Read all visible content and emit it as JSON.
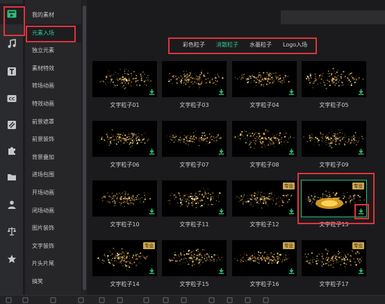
{
  "rail": {
    "items": [
      {
        "icon": "media-library-icon",
        "active": true
      },
      {
        "icon": "music-note-icon"
      },
      {
        "icon": "text-t-icon"
      },
      {
        "icon": "subtitle-cc-icon"
      },
      {
        "icon": "filter-icon"
      },
      {
        "icon": "puzzle-icon"
      },
      {
        "icon": "folder-icon"
      },
      {
        "icon": "person-icon"
      },
      {
        "icon": "balance-scale-icon"
      },
      {
        "icon": "star-icon"
      }
    ]
  },
  "menu": {
    "items": [
      {
        "label": "我的素材"
      },
      {
        "label": "元素入场",
        "active": true
      },
      {
        "label": "独立元素"
      },
      {
        "label": "素材特效"
      },
      {
        "label": "转场动画"
      },
      {
        "label": "特效动画"
      },
      {
        "label": "前景遮罩"
      },
      {
        "label": "前景装饰"
      },
      {
        "label": "背景叠加"
      },
      {
        "label": "进场包围"
      },
      {
        "label": "开场动画"
      },
      {
        "label": "闭场动画"
      },
      {
        "label": "图片装饰"
      },
      {
        "label": "文字装饰"
      },
      {
        "label": "片头片尾"
      },
      {
        "label": "搞笑"
      }
    ]
  },
  "subtabs": [
    {
      "label": "彩色粒子"
    },
    {
      "label": "消散粒子",
      "active": true
    },
    {
      "label": "水墨粒子"
    },
    {
      "label": "Logo入场"
    }
  ],
  "grid": {
    "pro_label": "专业",
    "items": [
      {
        "label": "文字粒子01"
      },
      {
        "label": "文字粒子03"
      },
      {
        "label": "文字粒子04"
      },
      {
        "label": "文字粒子05"
      },
      {
        "label": "文字粒子06"
      },
      {
        "label": "文字粒子07"
      },
      {
        "label": "文字粒子08"
      },
      {
        "label": "文字粒子09"
      },
      {
        "label": "文字粒子10"
      },
      {
        "label": "文字粒子11"
      },
      {
        "label": "文字粒子12",
        "pro": true
      },
      {
        "label": "文字粒子13",
        "pro": true,
        "selected": true
      },
      {
        "label": "文字粒子14",
        "pro": true
      },
      {
        "label": "文字粒子15"
      },
      {
        "label": "文字粒子16",
        "pro": true
      },
      {
        "label": "文字粒子17",
        "pro": true
      }
    ]
  },
  "colors": {
    "accent": "#35c58f",
    "pro_badge": "#c9a650",
    "annotation_red": "#e0343b",
    "particle_gold": "#d9a441"
  }
}
